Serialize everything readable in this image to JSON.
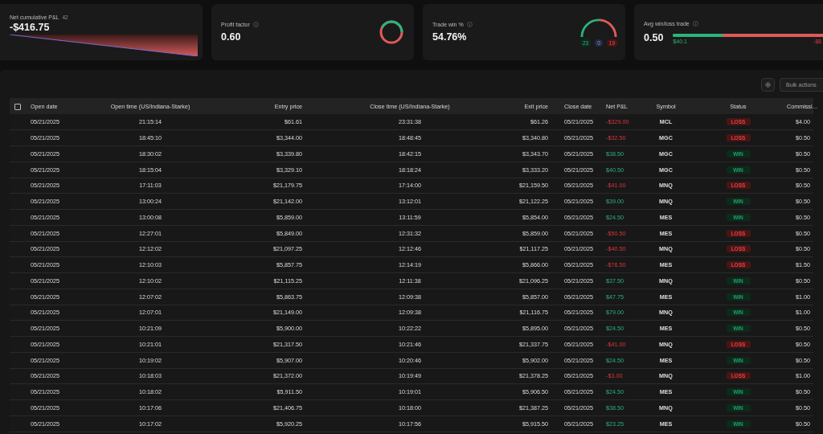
{
  "cards": [
    {
      "kind": "pnl",
      "title": "Net cumulative P&L",
      "badge": "42",
      "value": "-$416.75"
    },
    {
      "kind": "donut",
      "title": "Profit factor",
      "value": "0.60"
    },
    {
      "kind": "gauge",
      "title": "Trade win %",
      "value": "54.76%",
      "counts": [
        "23",
        "0",
        "19"
      ]
    },
    {
      "kind": "bar",
      "title": "Avg win/loss trade",
      "value": "0.50",
      "level": 0.33,
      "win": "$40.1",
      "loss": "-$8"
    }
  ],
  "toolbar": {
    "bulk_actions": "Bulk actions"
  },
  "table": {
    "select_all": {
      "checked": false
    },
    "columns": [
      "Open date",
      "Open time (US/Indiana-Starke)",
      "Entry price",
      "Close time (US/Indiana-Starke)",
      "Exit price",
      "Close date",
      "Net P&L",
      "Symbol",
      "Status",
      "Commissi…"
    ],
    "rows": [
      {
        "cells": [
          "05/21/2025",
          "21:15:14",
          "$61.61",
          "23:31:38",
          "$61.26",
          "05/21/2025",
          "-$329.00",
          "MCL"
        ],
        "status": {
          "label": "LOSS",
          "kind": "loss"
        },
        "commission": "$4.00"
      },
      {
        "cells": [
          "05/21/2025",
          "18:45:10",
          "$3,344.00",
          "18:48:45",
          "$3,340.80",
          "05/21/2025",
          "-$32.50",
          "MGC"
        ],
        "status": {
          "label": "LOSS",
          "kind": "loss"
        },
        "commission": "$0.50"
      },
      {
        "cells": [
          "05/21/2025",
          "18:30:02",
          "$3,339.80",
          "18:42:15",
          "$3,343.70",
          "05/21/2025",
          "$38.50",
          "MGC"
        ],
        "status": {
          "label": "WIN",
          "kind": "win"
        },
        "commission": "$0.50"
      },
      {
        "cells": [
          "05/21/2025",
          "18:15:04",
          "$3,329.10",
          "18:18:24",
          "$3,333.20",
          "05/21/2025",
          "$40.50",
          "MGC"
        ],
        "status": {
          "label": "WIN",
          "kind": "win"
        },
        "commission": "$0.50"
      },
      {
        "cells": [
          "05/21/2025",
          "17:11:03",
          "$21,179.75",
          "17:14:00",
          "$21,159.50",
          "05/21/2025",
          "-$41.00",
          "MNQ"
        ],
        "status": {
          "label": "LOSS",
          "kind": "loss"
        },
        "commission": "$0.50"
      },
      {
        "cells": [
          "05/21/2025",
          "13:00:24",
          "$21,142.00",
          "13:12:01",
          "$21,122.25",
          "05/21/2025",
          "$39.00",
          "MNQ"
        ],
        "status": {
          "label": "WIN",
          "kind": "win"
        },
        "commission": "$0.50"
      },
      {
        "cells": [
          "05/21/2025",
          "13:00:08",
          "$5,859.00",
          "13:11:59",
          "$5,854.00",
          "05/21/2025",
          "$24.50",
          "MES"
        ],
        "status": {
          "label": "WIN",
          "kind": "win"
        },
        "commission": "$0.50"
      },
      {
        "cells": [
          "05/21/2025",
          "12:27:01",
          "$5,849.00",
          "12:31:32",
          "$5,859.00",
          "05/21/2025",
          "-$50.50",
          "MES"
        ],
        "status": {
          "label": "LOSS",
          "kind": "loss"
        },
        "commission": "$0.50"
      },
      {
        "cells": [
          "05/21/2025",
          "12:12:02",
          "$21,097.25",
          "12:12:46",
          "$21,117.25",
          "05/21/2025",
          "-$40.50",
          "MNQ"
        ],
        "status": {
          "label": "LOSS",
          "kind": "loss"
        },
        "commission": "$0.50"
      },
      {
        "cells": [
          "05/21/2025",
          "12:10:03",
          "$5,857.75",
          "12:14:19",
          "$5,866.00",
          "05/21/2025",
          "-$76.50",
          "MES"
        ],
        "status": {
          "label": "LOSS",
          "kind": "loss"
        },
        "commission": "$1.50"
      },
      {
        "cells": [
          "05/21/2025",
          "12:10:02",
          "$21,115.25",
          "12:11:38",
          "$21,096.25",
          "05/21/2025",
          "$37.50",
          "MNQ"
        ],
        "status": {
          "label": "WIN",
          "kind": "win"
        },
        "commission": "$0.50"
      },
      {
        "cells": [
          "05/21/2025",
          "12:07:02",
          "$5,863.75",
          "12:09:38",
          "$5,857.00",
          "05/21/2025",
          "$47.75",
          "MES"
        ],
        "status": {
          "label": "WIN",
          "kind": "win"
        },
        "commission": "$1.00"
      },
      {
        "cells": [
          "05/21/2025",
          "12:07:01",
          "$21,149.00",
          "12:09:38",
          "$21,116.75",
          "05/21/2025",
          "$79.00",
          "MNQ"
        ],
        "status": {
          "label": "WIN",
          "kind": "win"
        },
        "commission": "$1.00"
      },
      {
        "cells": [
          "05/21/2025",
          "10:21:09",
          "$5,900.00",
          "10:22:22",
          "$5,895.00",
          "05/21/2025",
          "$24.50",
          "MES"
        ],
        "status": {
          "label": "WIN",
          "kind": "win"
        },
        "commission": "$0.50"
      },
      {
        "cells": [
          "05/21/2025",
          "10:21:01",
          "$21,317.50",
          "10:21:46",
          "$21,337.75",
          "05/21/2025",
          "-$41.00",
          "MNQ"
        ],
        "status": {
          "label": "LOSS",
          "kind": "loss"
        },
        "commission": "$0.50"
      },
      {
        "cells": [
          "05/21/2025",
          "10:19:02",
          "$5,907.00",
          "10:20:46",
          "$5,902.00",
          "05/21/2025",
          "$24.50",
          "MES"
        ],
        "status": {
          "label": "WIN",
          "kind": "win"
        },
        "commission": "$0.50"
      },
      {
        "cells": [
          "05/21/2025",
          "10:18:03",
          "$21,372.00",
          "10:19:49",
          "$21,378.25",
          "05/21/2025",
          "-$3.00",
          "MNQ"
        ],
        "status": {
          "label": "LOSS",
          "kind": "loss"
        },
        "commission": "$1.00"
      },
      {
        "cells": [
          "05/21/2025",
          "10:18:02",
          "$5,911.50",
          "10:19:01",
          "$5,906.50",
          "05/21/2025",
          "$24.50",
          "MES"
        ],
        "status": {
          "label": "WIN",
          "kind": "win"
        },
        "commission": "$0.50"
      },
      {
        "cells": [
          "05/21/2025",
          "10:17:06",
          "$21,406.75",
          "10:18:00",
          "$21,387.25",
          "05/21/2025",
          "$38.50",
          "MNQ"
        ],
        "status": {
          "label": "WIN",
          "kind": "win"
        },
        "commission": "$0.50"
      },
      {
        "cells": [
          "05/21/2025",
          "10:17:02",
          "$5,920.25",
          "10:17:56",
          "$5,915.50",
          "05/21/2025",
          "$23.25",
          "MES"
        ],
        "status": {
          "label": "WIN",
          "kind": "win"
        },
        "commission": "$0.50"
      }
    ]
  }
}
